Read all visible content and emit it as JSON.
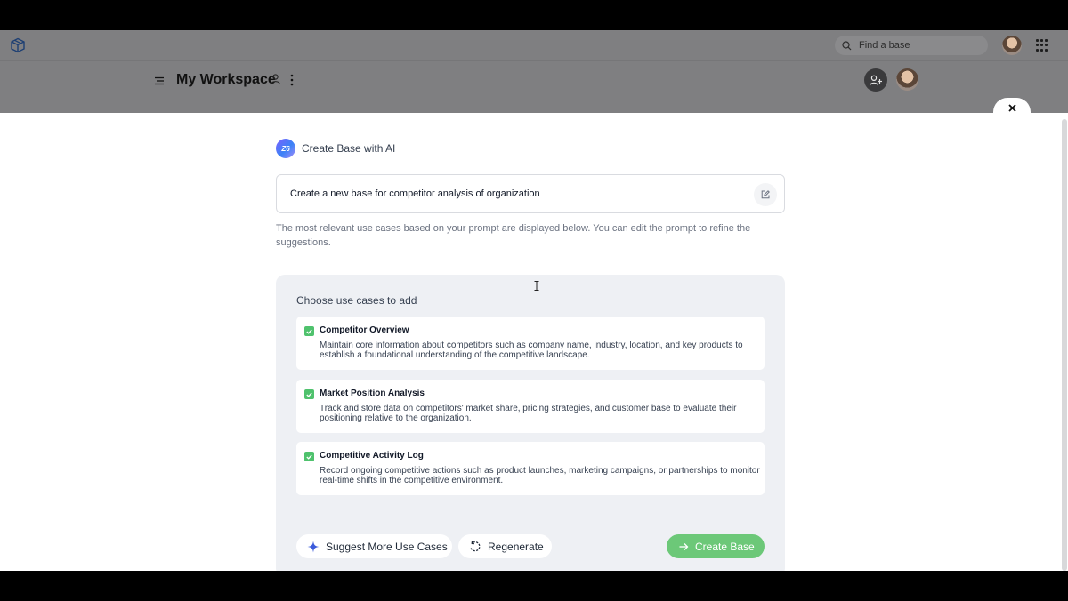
{
  "topbar": {
    "search_placeholder": "Find a base"
  },
  "workspace": {
    "title": "My Workspace"
  },
  "modal": {
    "title": "Create Base with AI",
    "ai_badge_text": "Z6",
    "prompt_value": "Create a new base for competitor analysis of organization",
    "helper_text": "The most relevant use cases based on your prompt are displayed below. You can edit the prompt to refine the suggestions.",
    "panel_title": "Choose use cases to add",
    "use_cases": [
      {
        "title": "Competitor Overview",
        "description": "Maintain core information about competitors such as company name, industry, location, and key products to establish a foundational understanding of the competitive landscape.",
        "checked": true
      },
      {
        "title": "Market Position Analysis",
        "description": "Track and store data on competitors' market share, pricing strategies, and customer base to evaluate their positioning relative to the organization.",
        "checked": true
      },
      {
        "title": "Competitive Activity Log",
        "description": "Record ongoing competitive actions such as product launches, marketing campaigns, or partnerships to monitor real-time shifts in the competitive environment.",
        "checked": true
      }
    ],
    "buttons": {
      "suggest_label": "Suggest More Use Cases",
      "regenerate_label": "Regenerate",
      "create_label": "Create Base"
    }
  },
  "colors": {
    "accent_green": "#6cc878",
    "check_green": "#4fc26d",
    "dim_overlay": "#7f7f81"
  },
  "icons": [
    "logo-icon",
    "search-icon",
    "apps-grid-icon",
    "menu-icon",
    "user-icon",
    "more-vertical-icon",
    "add-user-icon",
    "close-icon",
    "edit-icon",
    "check-icon",
    "sparkle-icon",
    "refresh-icon",
    "arrow-right-icon",
    "text-cursor-icon"
  ]
}
